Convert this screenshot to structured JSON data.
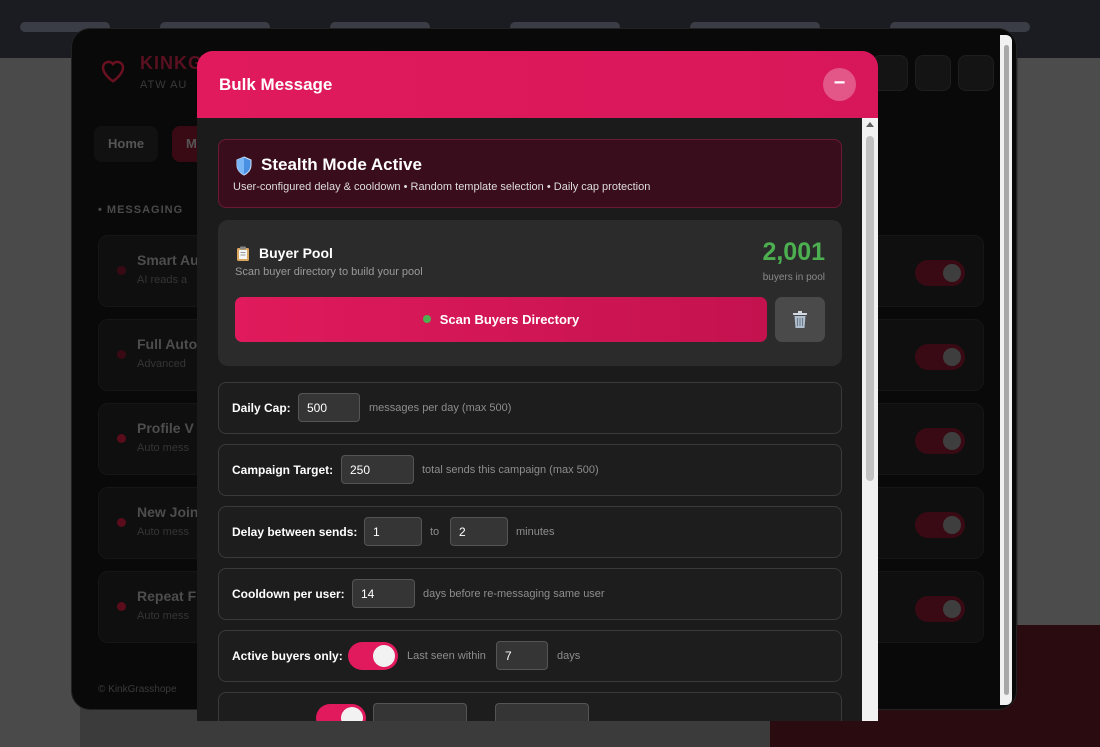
{
  "panel": {
    "brand": "KINKG",
    "brand_sub": "ATW AU",
    "tabs": [
      "Home",
      "M"
    ],
    "section_label": "MESSAGING",
    "features": [
      {
        "title": "Smart Au",
        "sub": "AI reads a"
      },
      {
        "title": "Full Auto",
        "sub": "Advanced"
      },
      {
        "title": "Profile V",
        "sub": "Auto mess"
      },
      {
        "title": "New Join",
        "sub": "Auto mess"
      },
      {
        "title": "Repeat F",
        "sub": "Auto mess"
      }
    ],
    "footer": "© KinkGrasshope"
  },
  "modal": {
    "title": "Bulk Message",
    "minimize_label": "−",
    "stealth": {
      "title": "Stealth Mode Active",
      "subtitle": "User-configured delay & cooldown • Random template selection • Daily cap protection"
    },
    "buyer_pool": {
      "title": "Buyer Pool",
      "subtitle": "Scan buyer directory to build your pool",
      "count": "2,001",
      "count_label": "buyers in pool",
      "scan_button": "Scan Buyers Directory",
      "status_color": "#4caf50"
    },
    "settings": {
      "daily_cap": {
        "label": "Daily Cap:",
        "value": "500",
        "hint": "messages per day (max 500)"
      },
      "campaign_target": {
        "label": "Campaign Target:",
        "value": "250",
        "hint": "total sends this campaign (max 500)"
      },
      "delay": {
        "label": "Delay between sends:",
        "min": "1",
        "to": "to",
        "max": "2",
        "unit": "minutes"
      },
      "cooldown": {
        "label": "Cooldown per user:",
        "value": "14",
        "hint": "days before re-messaging same user"
      },
      "active_only": {
        "label": "Active buyers only:",
        "enabled": true,
        "last_seen_label": "Last seen within",
        "days_value": "7",
        "days_unit": "days"
      }
    }
  },
  "colors": {
    "accent": "#e01a5c",
    "success": "#4caf50",
    "stealth_bg": "#3a0d1c"
  }
}
